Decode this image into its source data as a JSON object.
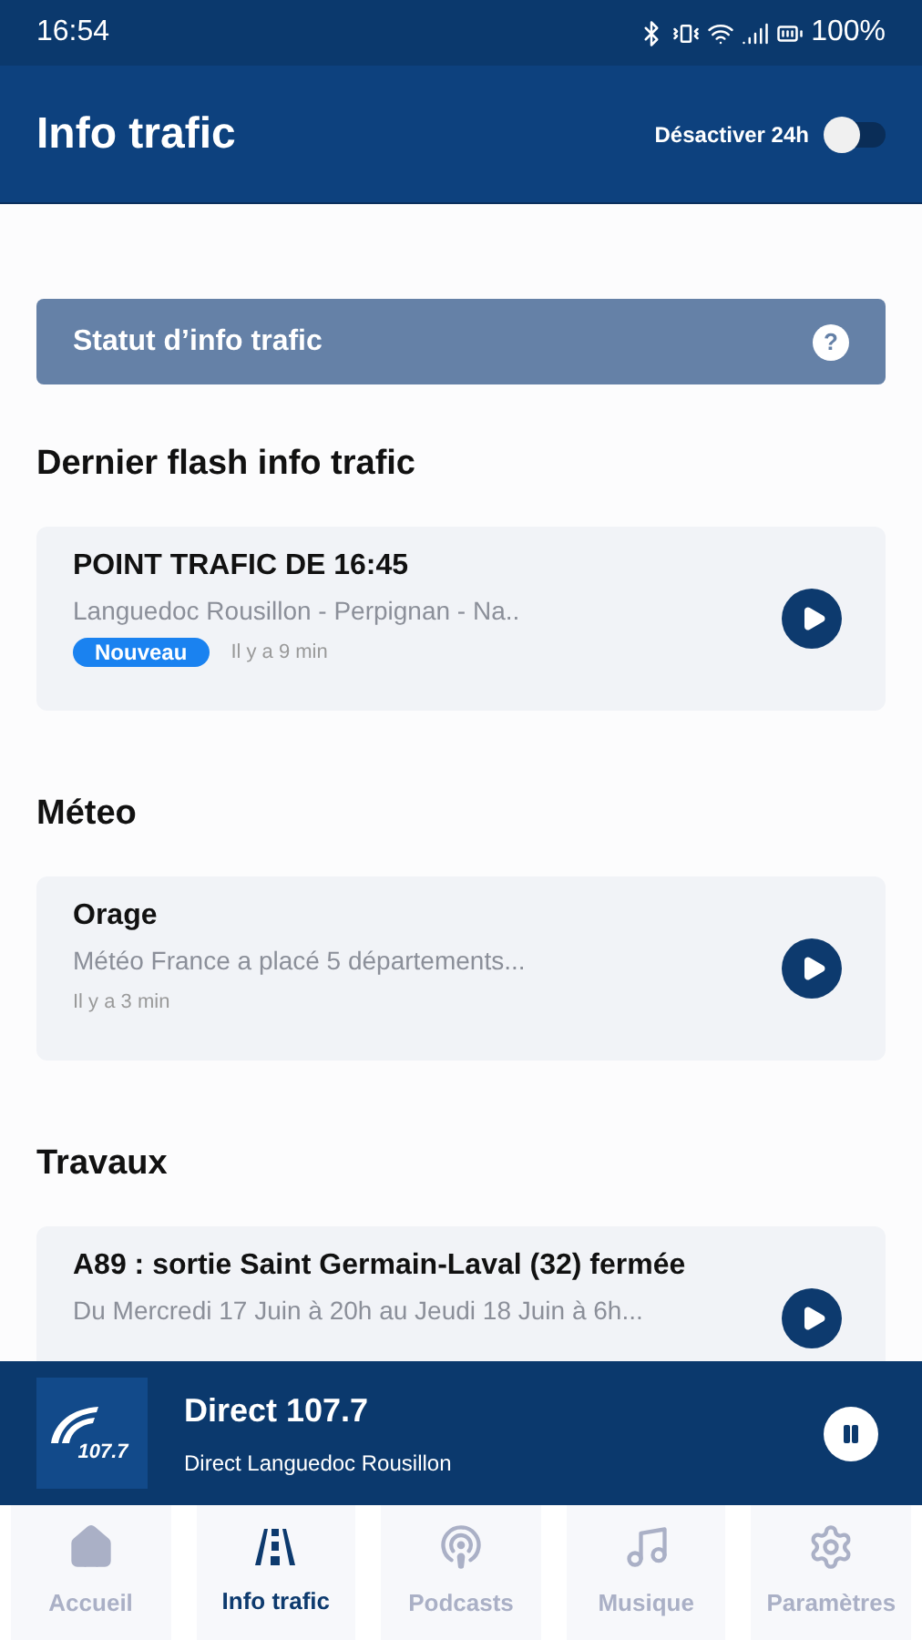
{
  "status_bar": {
    "time": "16:54",
    "battery": "100%"
  },
  "header": {
    "title": "Info trafic",
    "toggle_label": "Désactiver 24h",
    "toggle_on": false
  },
  "status_banner": {
    "label": "Statut d’info trafic",
    "help": "?"
  },
  "sections": [
    {
      "title": "Dernier flash info trafic",
      "cards": [
        {
          "title": "POINT TRAFIC DE 16:45",
          "subtitle": "Languedoc Rousillon - Perpignan - Na..",
          "badge": "Nouveau",
          "time": "Il y a 9 min"
        }
      ]
    },
    {
      "title": "Méteo",
      "cards": [
        {
          "title": "Orage",
          "subtitle": "Météo France a placé 5 départements...",
          "time": "Il y a 3 min"
        }
      ]
    },
    {
      "title": "Travaux",
      "cards": [
        {
          "title": "A89 : sortie Saint Germain-Laval (32) fermée",
          "subtitle": "Du Mercredi 17 Juin à 20h au Jeudi 18 Juin à 6h..."
        }
      ]
    }
  ],
  "player": {
    "logo_text": "107.7",
    "title": "Direct 107.7",
    "subtitle": "Direct Languedoc Rousillon",
    "playing": true
  },
  "nav": [
    {
      "label": "Accueil",
      "kind": "home",
      "selected": false
    },
    {
      "label": "Info trafic",
      "kind": "road",
      "selected": true
    },
    {
      "label": "Podcasts",
      "kind": "podcast",
      "selected": false
    },
    {
      "label": "Musique",
      "kind": "music",
      "selected": false
    },
    {
      "label": "Paramètres",
      "kind": "gear",
      "selected": false
    }
  ]
}
